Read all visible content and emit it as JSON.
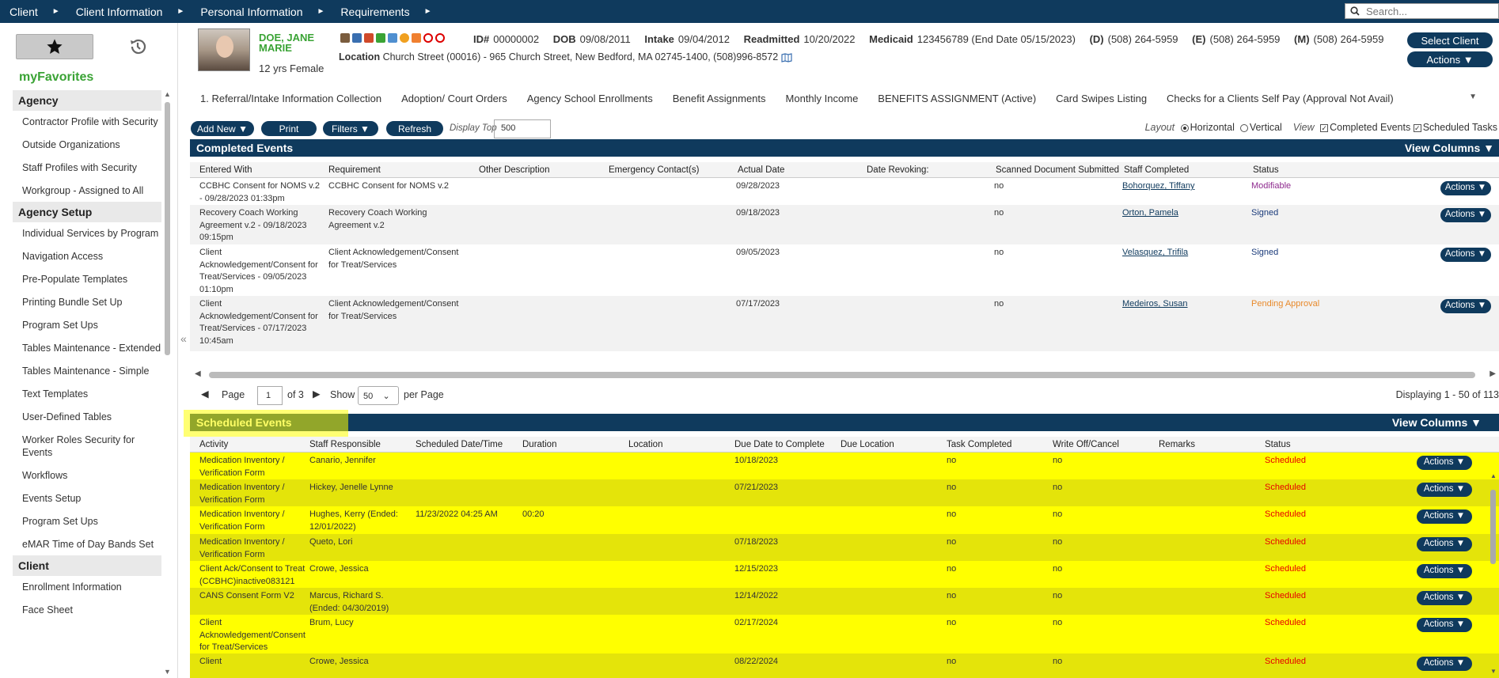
{
  "nav": {
    "crumbs": [
      "Client",
      "Client Information",
      "Personal Information",
      "Requirements"
    ],
    "search_placeholder": "Search..."
  },
  "sidebar": {
    "heading": "myFavorites",
    "sections": [
      {
        "title": "Agency",
        "items": [
          "Contractor Profile with Security",
          "Outside Organizations",
          "Staff Profiles with Security",
          "Workgroup - Assigned to All"
        ]
      },
      {
        "title": "Agency Setup",
        "items": [
          "Individual Services by Program",
          "Navigation Access",
          "Pre-Populate Templates",
          "Printing Bundle Set Up",
          "Program Set Ups",
          "Tables Maintenance - Extended",
          "Tables Maintenance - Simple",
          "Text Templates",
          "User-Defined Tables",
          "Worker Roles Security for Events",
          "Workflows",
          "Events Setup",
          "Program Set Ups",
          "eMAR Time of Day Bands Set"
        ]
      },
      {
        "title": "Client",
        "items": [
          "Enrollment Information",
          "Face Sheet"
        ]
      }
    ]
  },
  "client": {
    "name": "DOE, JANE MARIE",
    "age_sex": "12 yrs Female",
    "id_label": "ID#",
    "id": "00000002",
    "dob_label": "DOB",
    "dob": "09/08/2011",
    "intake_label": "Intake",
    "intake": "09/04/2012",
    "readmitted_label": "Readmitted",
    "readmitted": "10/20/2022",
    "medicaid_label": "Medicaid",
    "medicaid": "123456789 (End Date 05/15/2023)",
    "phone_d_label": "(D)",
    "phone_d": "(508) 264-5959",
    "phone_e_label": "(E)",
    "phone_e": "(508) 264-5959",
    "phone_m_label": "(M)",
    "phone_m": "(508) 264-5959",
    "location_label": "Location",
    "location": "Church Street (00016) - 965 Church Street, New Bedford, MA 02745-1400, (508)996-8572",
    "select_client": "Select Client",
    "actions": "Actions"
  },
  "tabs": [
    "1. Referral/Intake Information Collection",
    "Adoption/ Court Orders",
    "Agency School Enrollments",
    "Benefit Assignments",
    "Monthly Income",
    "BENEFITS ASSIGNMENT (Active)",
    "Card Swipes Listing",
    "Checks for a Clients Self Pay (Approval Not Avail)"
  ],
  "toolbar": {
    "add_new": "Add New",
    "print": "Print",
    "filters": "Filters",
    "refresh": "Refresh",
    "display_top_label": "Display Top",
    "display_top": "500",
    "layout_label": "Layout",
    "horizontal": "Horizontal",
    "vertical": "Vertical",
    "view_label": "View",
    "completed_events": "Completed Events",
    "scheduled_tasks": "Scheduled Tasks"
  },
  "completed": {
    "title": "Completed Events",
    "view_columns": "View Columns",
    "headers": [
      "Entered With",
      "Requirement",
      "Other Description",
      "Emergency Contact(s)",
      "Actual Date",
      "Date Revoking:",
      "Scanned Document Submitted",
      "Staff Completed",
      "Status"
    ],
    "rows": [
      {
        "entered": "CCBHC Consent for NOMS v.2 - 09/28/2023 01:33pm",
        "req": "CCBHC Consent for NOMS v.2",
        "date": "09/28/2023",
        "scanned": "no",
        "staff": "Bohorquez, Tiffany",
        "status": "Modifiable",
        "action": "Actions"
      },
      {
        "entered": "Recovery Coach Working Agreement v.2 - 09/18/2023 09:15pm",
        "req": "Recovery Coach Working Agreement v.2",
        "date": "09/18/2023",
        "scanned": "no",
        "staff": "Orton, Pamela",
        "status": "Signed",
        "action": "Actions"
      },
      {
        "entered": "Client Acknowledgement/Consent for Treat/Services - 09/05/2023 01:10pm",
        "req": "Client Acknowledgement/Consent for Treat/Services",
        "date": "09/05/2023",
        "scanned": "no",
        "staff": "Velasquez, Trifila",
        "status": "Signed",
        "action": "Actions"
      },
      {
        "entered": "Client Acknowledgement/Consent for Treat/Services - 07/17/2023 10:45am",
        "req": "Client Acknowledgement/Consent for Treat/Services",
        "date": "07/17/2023",
        "scanned": "no",
        "staff": "Medeiros, Susan",
        "status": "Pending Approval",
        "action": "Actions"
      }
    ],
    "pager": {
      "page_label": "Page",
      "page": "1",
      "of": "of 3",
      "show": "Show",
      "per_page_value": "50",
      "per_page": "per Page",
      "displaying": "Displaying 1 - 50 of 113"
    }
  },
  "scheduled": {
    "title": "Scheduled Events",
    "view_columns": "View Columns",
    "headers": [
      "Activity",
      "Staff Responsible",
      "Scheduled Date/Time",
      "Duration",
      "Location",
      "Due Date to Complete",
      "Due Location",
      "Task Completed",
      "Write Off/Cancel",
      "Remarks",
      "Status"
    ],
    "rows": [
      {
        "activity": "Medication Inventory / Verification Form",
        "staff": "Canario, Jennifer",
        "sched": "",
        "dur": "",
        "due": "10/18/2023",
        "task": "no",
        "wo": "no",
        "status": "Scheduled",
        "action": "Actions"
      },
      {
        "activity": "Medication Inventory / Verification Form",
        "staff": "Hickey, Jenelle Lynne",
        "sched": "",
        "dur": "",
        "due": "07/21/2023",
        "task": "no",
        "wo": "no",
        "status": "Scheduled",
        "action": "Actions"
      },
      {
        "activity": "Medication Inventory / Verification Form",
        "staff": "Hughes, Kerry (Ended: 12/01/2022)",
        "sched": "11/23/2022 04:25 AM",
        "dur": "00:20",
        "due": "",
        "task": "no",
        "wo": "no",
        "status": "Scheduled",
        "action": "Actions"
      },
      {
        "activity": "Medication Inventory / Verification Form",
        "staff": "Queto, Lori",
        "sched": "",
        "dur": "",
        "due": "07/18/2023",
        "task": "no",
        "wo": "no",
        "status": "Scheduled",
        "action": "Actions"
      },
      {
        "activity": "Client Ack/Consent to Treat (CCBHC)inactive083121",
        "staff": "Crowe, Jessica",
        "sched": "",
        "dur": "",
        "due": "12/15/2023",
        "task": "no",
        "wo": "no",
        "status": "Scheduled",
        "action": "Actions"
      },
      {
        "activity": "CANS Consent Form V2",
        "staff": "Marcus, Richard S. (Ended: 04/30/2019)",
        "sched": "",
        "dur": "",
        "due": "12/14/2022",
        "task": "no",
        "wo": "no",
        "status": "Scheduled",
        "action": "Actions"
      },
      {
        "activity": "Client Acknowledgement/Consent for Treat/Services",
        "staff": "Brum, Lucy",
        "sched": "",
        "dur": "",
        "due": "02/17/2024",
        "task": "no",
        "wo": "no",
        "status": "Scheduled",
        "action": "Actions"
      },
      {
        "activity": "Client",
        "staff": "Crowe, Jessica",
        "sched": "",
        "dur": "",
        "due": "08/22/2024",
        "task": "no",
        "wo": "no",
        "status": "Scheduled",
        "action": "Actions"
      }
    ]
  },
  "colors": {
    "navy": "#0f3a5d",
    "green": "#3aa335",
    "modifiable": "#8e2a8e",
    "signed": "#1a3a7a",
    "pending": "#e8892a",
    "scheduled": "#e60000",
    "highlight": "#ffff00"
  }
}
